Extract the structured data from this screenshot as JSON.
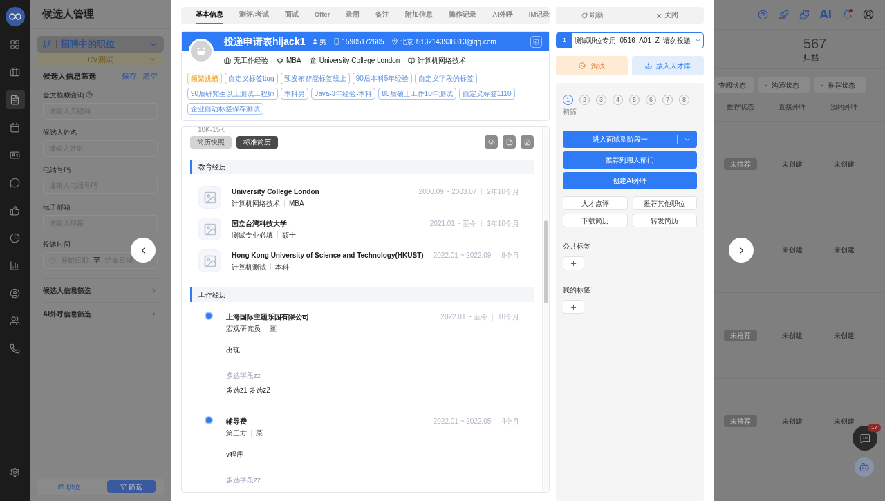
{
  "app": {
    "title": "候选人管理"
  },
  "nav": {
    "items": [
      {
        "selected": false
      },
      {
        "selected": false
      },
      {
        "selected": true
      },
      {
        "selected": false
      },
      {
        "selected": false
      },
      {
        "selected": false
      },
      {
        "selected": false
      },
      {
        "selected": false
      },
      {
        "selected": false
      },
      {
        "selected": false
      },
      {
        "selected": false
      },
      {
        "selected": false
      }
    ]
  },
  "filter_panel": {
    "position_selector": "招聘中的职位",
    "position_name": "CV测试",
    "title": "候选人信息筛选",
    "save": "保存",
    "clear": "清空",
    "fields": [
      {
        "label": "全文模糊查询",
        "help": true,
        "placeholder": "请输入关键词"
      },
      {
        "label": "候选人姓名",
        "help": false,
        "placeholder": "请输入姓名"
      },
      {
        "label": "电话号码",
        "help": false,
        "placeholder": "请输入电话号码"
      },
      {
        "label": "电子邮箱",
        "help": false,
        "placeholder": "请输入邮箱"
      }
    ],
    "date_range": {
      "label": "投递时间",
      "start": "开始日期",
      "separator": "至",
      "end": "结束日期"
    },
    "sections": [
      {
        "label": "候选人信息筛选"
      },
      {
        "label": "AI外呼信息筛选"
      }
    ],
    "bottom_tabs": [
      {
        "label": "职位",
        "selected": false
      },
      {
        "label": "筛选",
        "selected": true
      }
    ]
  },
  "modal": {
    "tabs": [
      {
        "label": "基本信息",
        "selected": true
      },
      {
        "label": "测评/考试",
        "selected": false
      },
      {
        "label": "面试",
        "selected": false
      },
      {
        "label": "Offer",
        "selected": false
      },
      {
        "label": "录用",
        "selected": false
      },
      {
        "label": "备注",
        "selected": false
      },
      {
        "label": "附加信息",
        "selected": false
      },
      {
        "label": "操作记录",
        "selected": false
      },
      {
        "label": "AI外呼",
        "selected": false
      },
      {
        "label": "IM记录",
        "selected": false
      }
    ],
    "profile": {
      "name": "投递申请表hijack1",
      "gender": "男",
      "phone": "15905172605",
      "city": "北京",
      "email": "32143938313@qq.com",
      "facts": [
        {
          "kind": "experience",
          "text": "无工作经验"
        },
        {
          "kind": "degree",
          "text": "MBA"
        },
        {
          "kind": "school",
          "text": "University College London"
        },
        {
          "kind": "major",
          "text": "计算机网络技术"
        }
      ],
      "tags": [
        {
          "label": "频繁跳槽",
          "kind": "warning"
        },
        {
          "label": "自定义标签ttqq",
          "kind": "normal"
        },
        {
          "label": "预发布智能标签线上",
          "kind": "normal"
        },
        {
          "label": "90后本科5年经验",
          "kind": "normal"
        },
        {
          "label": "自定义字段的标签",
          "kind": "normal"
        },
        {
          "label": "90后研究生以上测试工程师",
          "kind": "normal"
        },
        {
          "label": "本科男",
          "kind": "normal"
        },
        {
          "label": "Java-3年经验-本科",
          "kind": "normal"
        },
        {
          "label": "80后硕士工作10年测试",
          "kind": "normal"
        },
        {
          "label": "自定义标签1110",
          "kind": "normal"
        },
        {
          "label": "企业自动标签保存测试",
          "kind": "normal"
        }
      ]
    },
    "resume": {
      "salary": "10K-15K",
      "views": [
        {
          "label": "简历快照",
          "selected": false
        },
        {
          "label": "标准简历",
          "selected": true
        }
      ],
      "sections": [
        {
          "title": "教育经历",
          "kind": "education",
          "items": [
            {
              "name": "University College London",
              "detail": "计算机网络技术",
              "level": "MBA",
              "period": "2000.09 ~ 2003.07",
              "duration": "2年10个月"
            },
            {
              "name": "国立台湾科技大学",
              "detail": "测试专业必填",
              "level": "硕士",
              "period": "2021.01 ~ 至今",
              "duration": "1年10个月"
            },
            {
              "name": "Hong Kong University of Science and Technology(HKUST)",
              "detail": "计算机测试",
              "level": "本科",
              "period": "2022.01 ~ 2022.09",
              "duration": "8个月"
            }
          ]
        },
        {
          "title": "工作经历",
          "kind": "work",
          "items": [
            {
              "name": "上海国际主题乐园有限公司",
              "detail": "宏观研究员",
              "level": "菜",
              "period": "2022.01 ~ 至今",
              "duration": "10个月",
              "description": "出现",
              "field_label": "多选字段zz",
              "field_value": "多选z1 多选z2"
            },
            {
              "name": "辅导费",
              "detail": "第三方",
              "level": "菜",
              "period": "2022.01 ~ 2022.05",
              "duration": "4个月",
              "description": "v程序",
              "field_label": "多选字段zz"
            }
          ]
        }
      ]
    }
  },
  "side": {
    "refresh": "刷新",
    "close": "关闭",
    "stage_select": {
      "index": "1",
      "value": "测试职位专用_0516_A01_Z_请勿投递"
    },
    "reject": "淘汰",
    "talent_pool": "放入人才库",
    "steps": [
      {
        "label": "1",
        "selected": true
      },
      {
        "label": "2",
        "selected": false
      },
      {
        "label": "3",
        "selected": false
      },
      {
        "label": "4",
        "selected": false
      },
      {
        "label": "5",
        "selected": false
      },
      {
        "label": "6",
        "selected": false
      },
      {
        "label": "7",
        "selected": false
      },
      {
        "label": "8",
        "selected": false
      }
    ],
    "step_caption": "初筛",
    "primary_actions": [
      {
        "label": "进入面试型阶段一",
        "split": true
      },
      {
        "label": "推荐到用人部门",
        "split": false
      },
      {
        "label": "创建AI外呼",
        "split": false
      }
    ],
    "secondary_actions": [
      "人才点评",
      "推荐其他职位",
      "下载简历",
      "转发简历"
    ],
    "tag_groups": [
      {
        "title": "公共标签"
      },
      {
        "title": "我的标签"
      }
    ]
  },
  "background": {
    "toolbar_ai": "AI",
    "stat": {
      "value": "567",
      "label": "归档"
    },
    "filters": [
      "查阅状态",
      "沟通状态",
      "推荐状态"
    ],
    "columns": [
      "推荐状态",
      "直接外呼",
      "预约外呼"
    ],
    "rows": [
      {
        "status": "未推荐",
        "direct": "未创建",
        "scheduled": "未创建"
      },
      {
        "direct": "未创建",
        "scheduled": "未创建"
      },
      {
        "status": "未推荐",
        "direct": "未创建",
        "scheduled": "未创建"
      },
      {
        "status": "未推荐",
        "direct": "未创建",
        "scheduled": "未创建"
      }
    ],
    "chat_badge": "17"
  }
}
